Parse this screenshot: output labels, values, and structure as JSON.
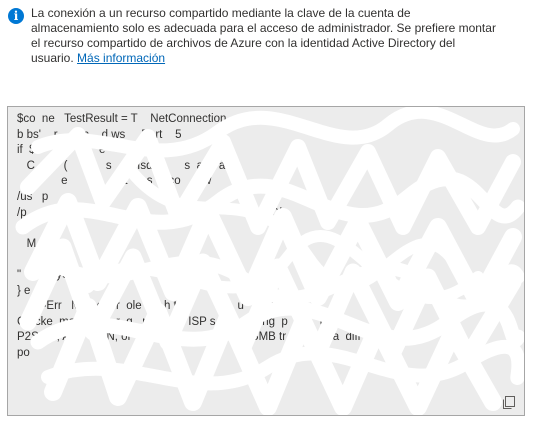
{
  "info": {
    "icon": "info-icon",
    "text": "La conexión a un recurso compartido mediante la clave de la cuenta de almacenamiento solo es adecuada para el acceso de administrador. Se prefiere montar el recurso compartido de archivos de Azure con la identidad Active Directory del usuario. ",
    "link_label": "Más información",
    "accent_color": "#0078d4",
    "link_color": "#0067b8"
  },
  "script": {
    "lines": [
      "$co  ne   TestResult = T    NetConnection    ur  ter    e",
      "b bs'    r     e.c    d ws     Port    5",
      "if  $c      T      t   e      eded",
      "   C  a     (            s        Isd          s  a     ar",
      "   c         e              ust      s     co     ow",
      "/us   p",
      "/p         Fl        w                            T              Hl    +C/",
      "C  ",
      "   M    a",
      "     ",
      "\"     o  ayes                  w       s\"  e",
      "} e",
      "     te-Err   Me   g    r  ole       h the           a  u        44",
      "C ecke  ma   s        r  g   r      on r ISP s   ot      king  p          us   A",
      "P2S   N, A   r   S  N, or   press Route t     nn    SMB tr  s    ve   a  diff  ent",
      "po"
    ],
    "copy_icon": "copy-icon",
    "background_color": "#ececec"
  }
}
